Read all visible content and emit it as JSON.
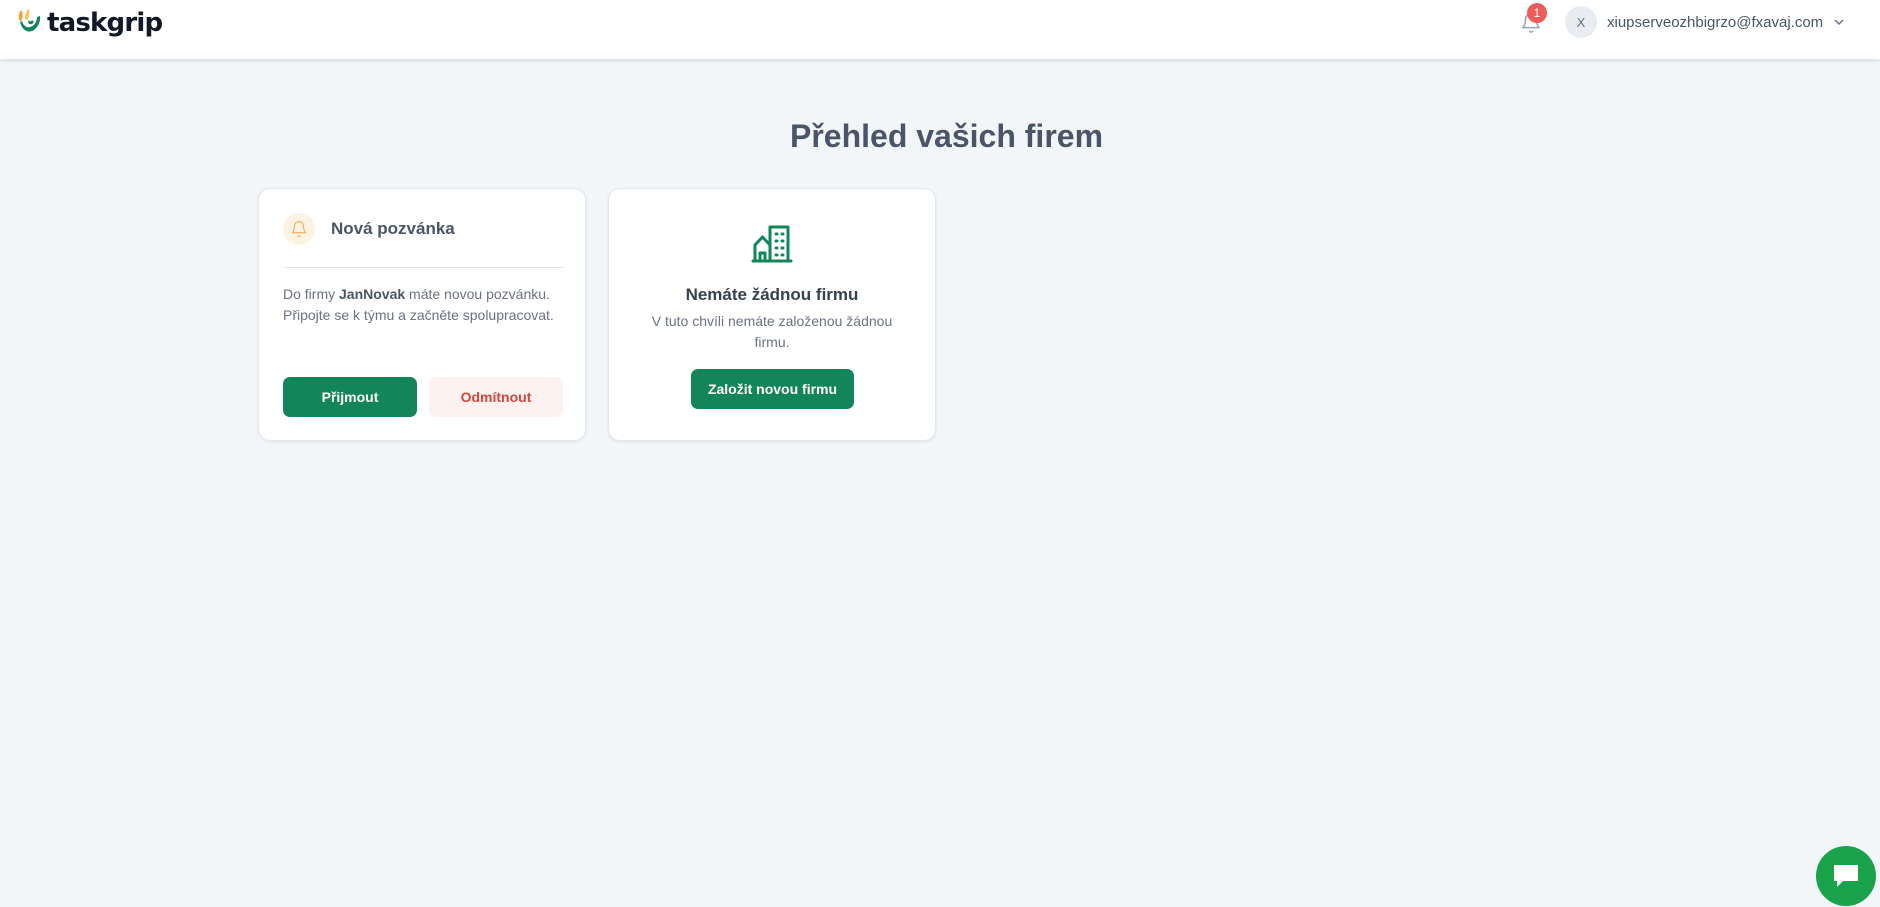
{
  "app": {
    "logo_text": "taskgrip",
    "brand_green": "#13855a",
    "logo_icon": "leaf-sprout-icon"
  },
  "header": {
    "notifications": {
      "icon": "bell-icon",
      "count": "1"
    },
    "user": {
      "avatar_initial": "X",
      "email": "xiupserveozhbigrzo@fxavaj.com",
      "dropdown_icon": "chevron-down-icon"
    }
  },
  "main": {
    "title": "Přehled vašich firem",
    "invite_card": {
      "icon": "bell-icon",
      "title": "Nová pozvánka",
      "text_prefix": "Do firmy ",
      "company": "JanNovak",
      "text_suffix": " máte novou pozvánku. Připojte se k týmu a začněte spolupracovat.",
      "accept_label": "Přijmout",
      "reject_label": "Odmítnout"
    },
    "empty_card": {
      "icon": "building-icon",
      "title": "Nemáte žádnou firmu",
      "text": "V tuto chvíli nemáte založenou žádnou firmu.",
      "create_label": "Založit novou firmu"
    }
  },
  "chat": {
    "icon": "chat-bubble-icon",
    "color": "#1aa34a"
  }
}
